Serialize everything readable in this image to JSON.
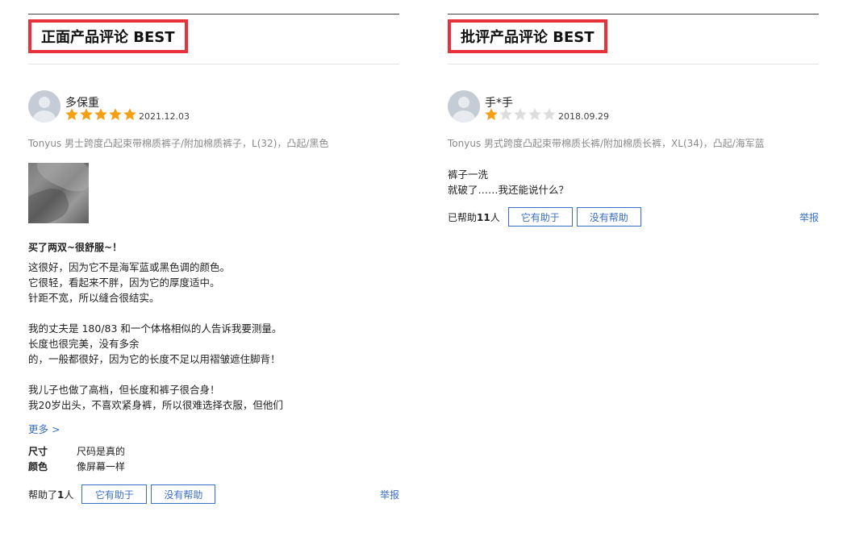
{
  "left": {
    "section_title": "正面产品评论 BEST",
    "username": "多保重",
    "rating": 5,
    "date": "2021.12.03",
    "product": "Tonyus 男士跨度凸起束带棉质裤子/附加棉质裤子，L(32)，凸起/黑色",
    "review_title": "买了两双~很舒服~！",
    "body_lines": [
      "这很好，因为它不是海军蓝或黑色调的颜色。",
      "它很轻，看起来不胖，因为它的厚度适中。",
      "针距不宽，所以缝合很结实。",
      "",
      "我的丈夫是 180/83 和一个体格相似的人告诉我要测量。",
      "长度也很完美，没有多余",
      "的，一般都很好，因为它的长度不足以用褶皱遮住脚背！",
      "",
      "我儿子也做了高档，但长度和裤子很合身！",
      "我20岁出头，不喜欢紧身裤，所以很难选择衣服，但他们"
    ],
    "more_label": "更多 >",
    "attributes": [
      {
        "key": "尺寸",
        "value": "尺码是真的"
      },
      {
        "key": "颜色",
        "value": "像屏幕一样"
      }
    ],
    "helpful_prefix": "帮助了",
    "helpful_count": "1",
    "helpful_suffix": "人",
    "helpful_button": "它有助于",
    "not_helpful_button": "没有帮助",
    "report_label": "举报"
  },
  "right": {
    "section_title": "批评产品评论 BEST",
    "username": "手*手",
    "rating": 1,
    "date": "2018.09.29",
    "product": "Tonyus 男式跨度凸起束带棉质长裤/附加棉质长裤，XL(34)，凸起/海军蓝",
    "body_lines": [
      "裤子一洗",
      "就破了……我还能说什么？"
    ],
    "helpful_prefix": "已帮助",
    "helpful_count": "11",
    "helpful_suffix": "人",
    "helpful_button": "它有助于",
    "not_helpful_button": "没有帮助",
    "report_label": "举报"
  },
  "colors": {
    "accent_red": "#e8323b",
    "star_on": "#f5a012",
    "star_off": "#dddddd",
    "link_blue": "#3a6fc4"
  },
  "icons": {
    "avatar": "user-avatar-icon",
    "star": "star-icon"
  }
}
